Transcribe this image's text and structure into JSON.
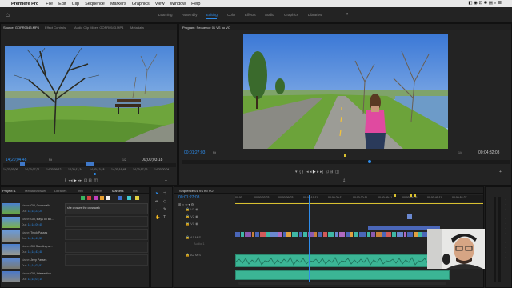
{
  "menubar": {
    "app": "Premiere Pro",
    "items": [
      "File",
      "Edit",
      "Clip",
      "Sequence",
      "Markers",
      "Graphics",
      "View",
      "Window",
      "Help"
    ],
    "right_icons": "◧ ◉ ⊡ ✱ ▤ ⌕ ☰"
  },
  "workspaces": [
    "Learning",
    "Assembly",
    "Editing",
    "Color",
    "Effects",
    "Audio",
    "Graphics",
    "Libraries"
  ],
  "workspace_active": "Editing",
  "source": {
    "tabs": [
      "Source: GOPR0543.MP4",
      "Effect Controls",
      "Audio Clip Mixer: GOPR0543.MP4",
      "Metadata"
    ],
    "timecode": "14;20;04;48",
    "fit": "Fit",
    "zoom": "1/2",
    "duration": "00;00;03;18",
    "ruler": [
      "14;27;03;09",
      "14;20;07;21",
      "14;20;09;12",
      "14;20;11;34",
      "14;20;13;18",
      "14;20;16;48",
      "14;20;17;36",
      "14;20;20;04"
    ]
  },
  "program": {
    "tabs": [
      "Program: Sequence 01 VS no VO"
    ],
    "timecode": "00:01:27:03",
    "fit": "Fit",
    "zoom": "1/4",
    "duration": "00:04:32:03"
  },
  "project": {
    "tabs": [
      "Project: 1",
      "Media Browser",
      "Libraries",
      "Info",
      "Effects",
      "Markers",
      "Hist"
    ],
    "items": [
      {
        "name": "Girl, Crosswalk",
        "dur": "14;14;23;20"
      },
      {
        "name": "Girl, stays on Bo...",
        "dur": "14;14;09;45"
      },
      {
        "name": "Truck Passes",
        "dur": "14;14;49;55"
      },
      {
        "name": "Girl Standing wi...",
        "dur": "14;14;43;48"
      },
      {
        "name": "Jeep Passes",
        "dur": "14;14;03;51"
      },
      {
        "name": "Girl, Intersection",
        "dur": "14;14;01;15"
      }
    ],
    "labels": {
      "name": "Name",
      "dur": "Dur"
    },
    "marker_comment": "she crosses the crosswalk"
  },
  "timeline": {
    "tab": "Sequence 01 VS no VO",
    "timecode": "00:01:27:03",
    "ruler": [
      "00:00",
      "00:00:03:23",
      "00:00:09:23",
      "00:00:19:11",
      "00:00:29:11",
      "00:00:30:11",
      "00:00:39:11",
      "00:00:44:03",
      "00:00:49:11",
      "00:00:59:04",
      "00:00:54:27"
    ],
    "tracks": [
      {
        "name": "V3"
      },
      {
        "name": "V2"
      },
      {
        "name": "V1"
      },
      {
        "name": "A1"
      },
      {
        "name": "A2"
      }
    ],
    "audio_label": "Audio 1"
  },
  "colors": {
    "accent": "#2d8ceb",
    "clip_blue": "#4a66b8",
    "clip_teal": "#3fb7a5",
    "audio_green": "#3bb595"
  }
}
